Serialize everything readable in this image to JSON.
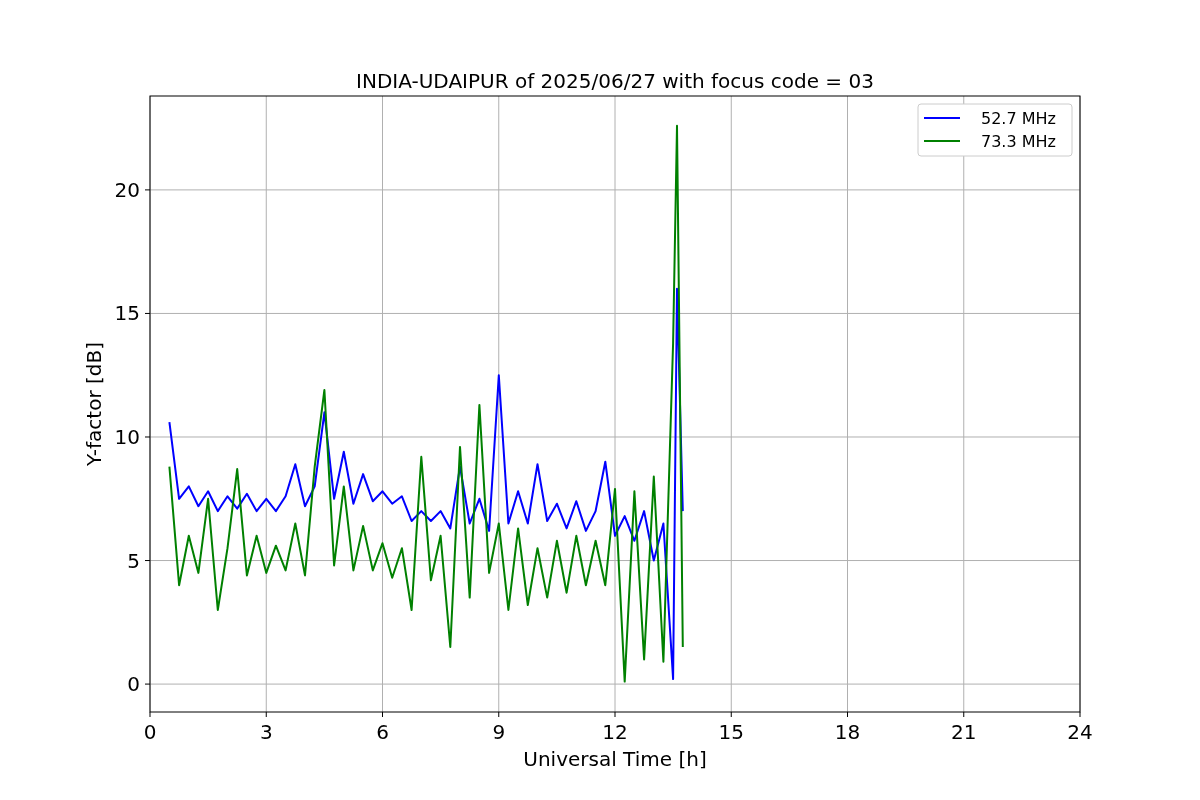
{
  "chart_data": {
    "type": "line",
    "title": "INDIA-UDAIPUR of 2025/06/27 with focus code = 03",
    "xlabel": "Universal Time [h]",
    "ylabel": "Y-factor [dB]",
    "xlim": [
      0,
      24
    ],
    "ylim": [
      -1.13,
      23.8
    ],
    "xticks": [
      0,
      3,
      6,
      9,
      12,
      15,
      18,
      21,
      24
    ],
    "yticks": [
      0,
      5,
      10,
      15,
      20
    ],
    "grid": true,
    "legend": true,
    "x": [
      0.5,
      0.75,
      1.0,
      1.25,
      1.5,
      1.75,
      2.0,
      2.25,
      2.5,
      2.75,
      3.0,
      3.25,
      3.5,
      3.75,
      4.0,
      4.25,
      4.5,
      4.75,
      5.0,
      5.25,
      5.5,
      5.75,
      6.0,
      6.25,
      6.5,
      6.75,
      7.0,
      7.25,
      7.5,
      7.75,
      8.0,
      8.25,
      8.5,
      8.75,
      9.0,
      9.25,
      9.5,
      9.75,
      10.0,
      10.25,
      10.5,
      10.75,
      11.0,
      11.25,
      11.5,
      11.75,
      12.0,
      12.25,
      12.5,
      12.75,
      13.0,
      13.25,
      13.5,
      13.6,
      13.75
    ],
    "series": [
      {
        "name": "52.7 MHz",
        "color": "#0000ff",
        "values": [
          10.6,
          7.5,
          8.0,
          7.2,
          7.8,
          7.0,
          7.6,
          7.1,
          7.7,
          7.0,
          7.5,
          7.0,
          7.6,
          8.9,
          7.2,
          8.0,
          11.0,
          7.5,
          9.4,
          7.3,
          8.5,
          7.4,
          7.8,
          7.3,
          7.6,
          6.6,
          7.0,
          6.6,
          7.0,
          6.3,
          8.8,
          6.5,
          7.5,
          6.2,
          12.5,
          6.5,
          7.8,
          6.5,
          8.9,
          6.6,
          7.3,
          6.3,
          7.4,
          6.2,
          7.0,
          9.0,
          6.0,
          6.8,
          5.8,
          7.0,
          5.0,
          6.5,
          0.2,
          16.0,
          7.0
        ]
      },
      {
        "name": "73.3 MHz",
        "color": "#008000",
        "values": [
          8.8,
          4.0,
          6.0,
          4.5,
          7.5,
          3.0,
          5.5,
          8.7,
          4.4,
          6.0,
          4.5,
          5.6,
          4.6,
          6.5,
          4.4,
          8.8,
          11.9,
          4.8,
          8.0,
          4.6,
          6.4,
          4.6,
          5.7,
          4.3,
          5.5,
          3.0,
          9.2,
          4.2,
          6.0,
          1.5,
          9.6,
          3.5,
          11.3,
          4.5,
          6.5,
          3.0,
          6.3,
          3.2,
          5.5,
          3.5,
          5.8,
          3.7,
          6.0,
          4.0,
          5.8,
          4.0,
          7.9,
          0.1,
          7.8,
          1.0,
          8.4,
          0.9,
          13.8,
          22.6,
          1.5
        ]
      }
    ]
  }
}
